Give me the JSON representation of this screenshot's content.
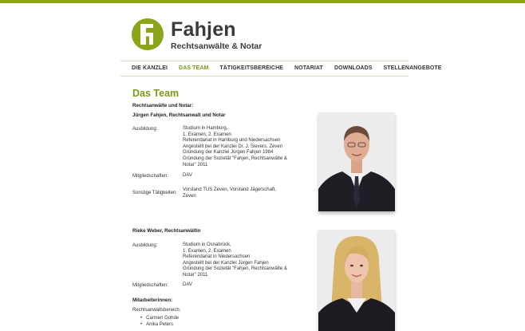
{
  "brand": {
    "name": "Fahjen",
    "subtitle": "Rechtsanwälte & Notar",
    "color": "#7b9a12"
  },
  "nav": {
    "items": [
      {
        "label": "DIE KANZLEI",
        "active": false
      },
      {
        "label": "DAS TEAM",
        "active": true
      },
      {
        "label": "TÄTIGKEITSBEREICHE",
        "active": false
      },
      {
        "label": "NOTARIAT",
        "active": false
      },
      {
        "label": "DOWNLOADS",
        "active": false
      },
      {
        "label": "STELLENANGEBOTE",
        "active": false
      }
    ]
  },
  "page": {
    "title": "Das Team",
    "section1": "Rechtsanwälte und Notar:",
    "person1": {
      "name": "Jürgen Fahjen, Rechtsanwalt und Notar",
      "ausbildung_label": "Ausbildung:",
      "ausbildung": [
        "Studium in Hamburg,",
        "1. Examen, 2. Examen",
        "Referendariat in Hamburg und Niedersachsen",
        "Angestellt bei der Kanzlei Dr. J. Sievers, Zeven",
        "Gründung der Kanzlei Jürgen Fahjen 1984",
        "Gründung der Sozietät \"Fahjen, Rechtsanwälte &",
        "Notar\" 2011"
      ],
      "mitglied_label": "Mitgliedschaften:",
      "mitglied": "DAV",
      "sonstige_label": "Sonstige Tätigkeiten:",
      "sonstige": [
        "Vorstand TUS Zeven, Vorstand Jägerschaft,",
        "Zeven"
      ]
    },
    "person2": {
      "name": "Rieke Weber, Rechtsanwältin",
      "ausbildung_label": "Ausbildung:",
      "ausbildung": [
        "Studium in Osnabrück,",
        "1. Examen, 2. Examen",
        "Referendariat in Niedersachsen",
        "Angestellt bei der Kanzlei Jürgen Fahjen",
        "Gründung der Sozietät \"Fahjen, Rechtsanwälte &",
        "Notar\" 2011"
      ],
      "mitglied_label": "Mitgliedschaften:",
      "mitglied": "DAV"
    },
    "section2": "Mitarbeiterinnen:",
    "staff_label": "Rechtsanwaltsbereich:",
    "staff": [
      "Carmen Gohde",
      "Anika Peters"
    ]
  }
}
